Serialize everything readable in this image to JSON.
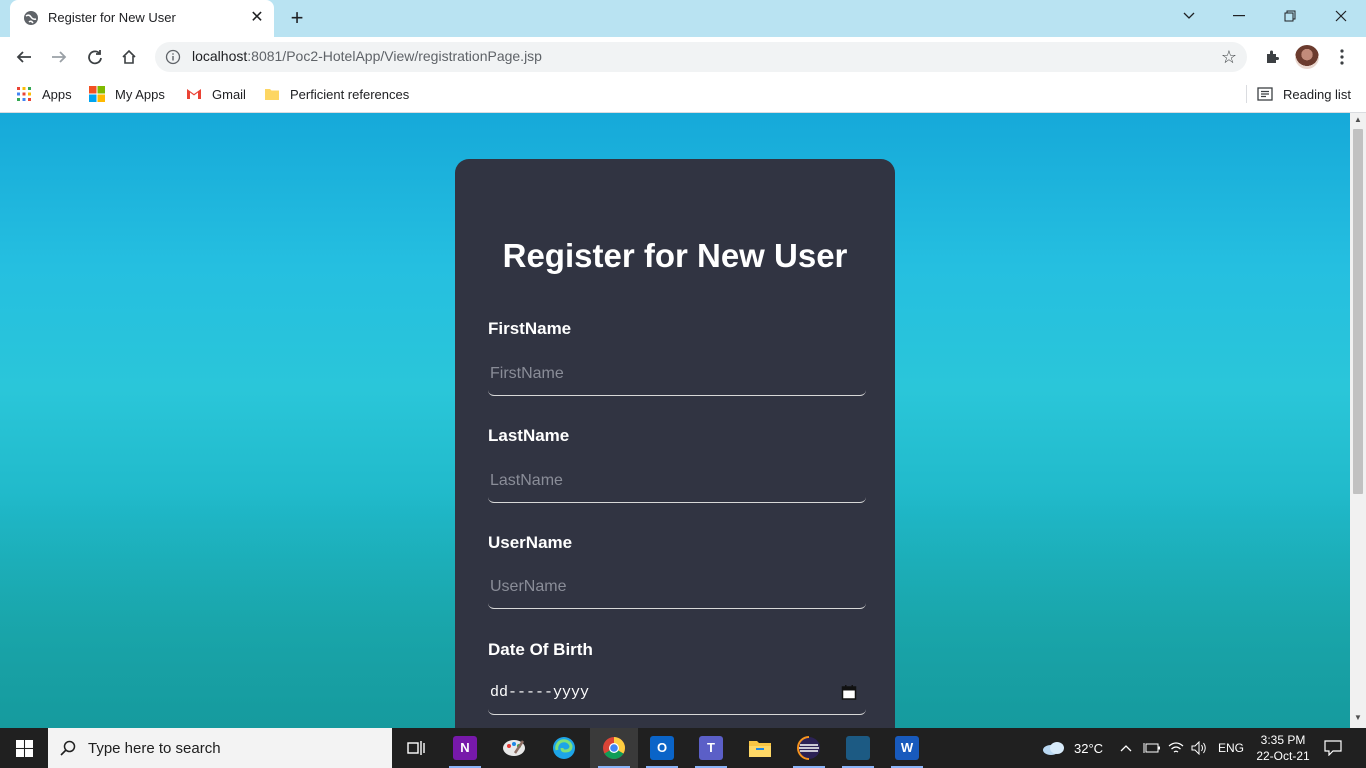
{
  "browser": {
    "tab_title": "Register for New User",
    "url_host": "localhost",
    "url_path": ":8081/Poc2-HotelApp/View/registrationPage.jsp",
    "bookmarks": [
      {
        "label": "Apps"
      },
      {
        "label": "My Apps"
      },
      {
        "label": "Gmail"
      },
      {
        "label": "Perficient references"
      }
    ],
    "reading_list": "Reading list"
  },
  "form": {
    "heading": "Register for New User",
    "fields": [
      {
        "label": "FirstName",
        "placeholder": "FirstName"
      },
      {
        "label": "LastName",
        "placeholder": "LastName"
      },
      {
        "label": "UserName",
        "placeholder": "UserName"
      }
    ],
    "dob_label": "Date Of Birth",
    "dob_placeholder": "dd-----yyyy"
  },
  "taskbar": {
    "search_placeholder": "Type here to search",
    "weather": "32°C",
    "language": "ENG",
    "time": "3:35 PM",
    "date": "22-Oct-21"
  },
  "colors": {
    "card_bg": "#313442",
    "page_bg_top": "#16a9d9",
    "page_bg_bottom": "#17a9a6",
    "tabbar_bg": "#b9e3f2"
  }
}
